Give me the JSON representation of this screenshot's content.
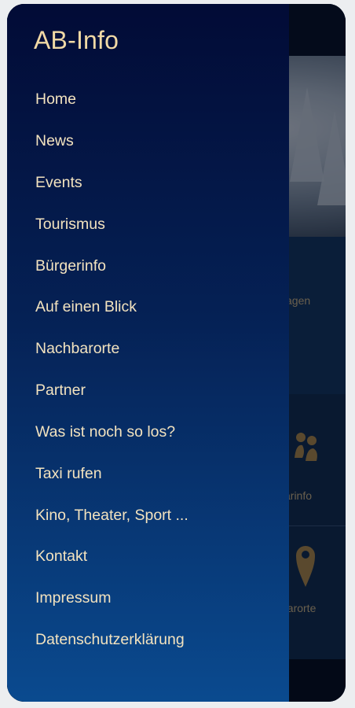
{
  "drawer": {
    "title": "AB-Info",
    "items": [
      {
        "label": "Home"
      },
      {
        "label": "News"
      },
      {
        "label": "Events"
      },
      {
        "label": "Tourismus"
      },
      {
        "label": "Bürgerinfo"
      },
      {
        "label": "Auf einen Blick"
      },
      {
        "label": "Nachbarorte"
      },
      {
        "label": "Partner"
      },
      {
        "label": "Was ist noch so los?"
      },
      {
        "label": "Taxi rufen"
      },
      {
        "label": "Kino, Theater, Sport ..."
      },
      {
        "label": "Kontakt"
      },
      {
        "label": "Impressum"
      },
      {
        "label": "Datenschutzerklärung"
      }
    ]
  },
  "background": {
    "label_1": "agen",
    "label_2": "arinfo",
    "label_3": "barorte"
  },
  "colors": {
    "drawer_top": "#020b36",
    "drawer_bottom": "#0a4a8f",
    "accent_text": "#f1d9a5"
  }
}
